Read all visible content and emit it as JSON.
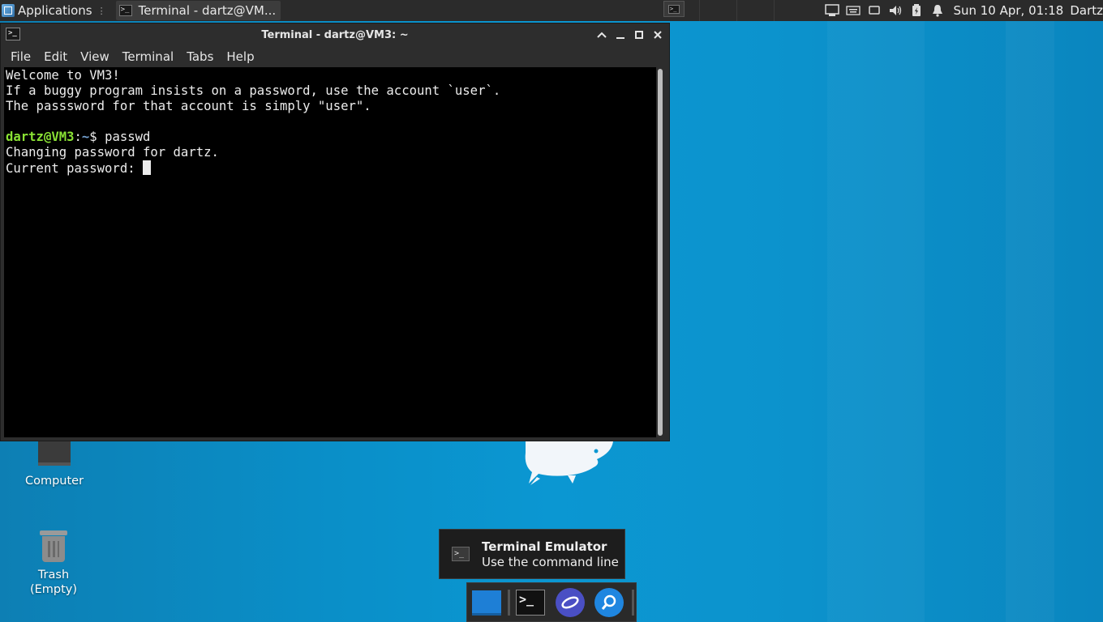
{
  "panel": {
    "apps_label": "Applications",
    "task_title": "Terminal - dartz@VM...",
    "clock": "Sun 10 Apr, 01:18",
    "user": "Dartz"
  },
  "window": {
    "title": "Terminal - dartz@VM3: ~",
    "menu": [
      "File",
      "Edit",
      "View",
      "Terminal",
      "Tabs",
      "Help"
    ]
  },
  "terminal": {
    "lines": [
      "Welcome to VM3!",
      "If a buggy program insists on a password, use the account `user`.",
      "The passsword for that account is simply \"user\".",
      ""
    ],
    "prompt_user": "dartz@VM3",
    "prompt_sep": ":",
    "prompt_path": "~",
    "prompt_symbol": "$ ",
    "command": "passwd",
    "output": [
      "Changing password for dartz.",
      "Current password: "
    ]
  },
  "desktop": {
    "computer_label": "Computer",
    "trash_label_1": "Trash",
    "trash_label_2": "(Empty)"
  },
  "tooltip": {
    "title": "Terminal Emulator",
    "description": "Use the command line"
  },
  "icons": {
    "apps": "applications-menu-icon",
    "terminal": "terminal-icon",
    "network": "network-icon",
    "keyboard": "keyboard-icon",
    "display": "display-icon",
    "volume": "volume-icon",
    "battery": "battery-icon",
    "notifications": "bell-icon"
  },
  "colors": {
    "prompt_user": "#8ae234",
    "prompt_path": "#729fcf",
    "desktop": "#0b97d2"
  }
}
